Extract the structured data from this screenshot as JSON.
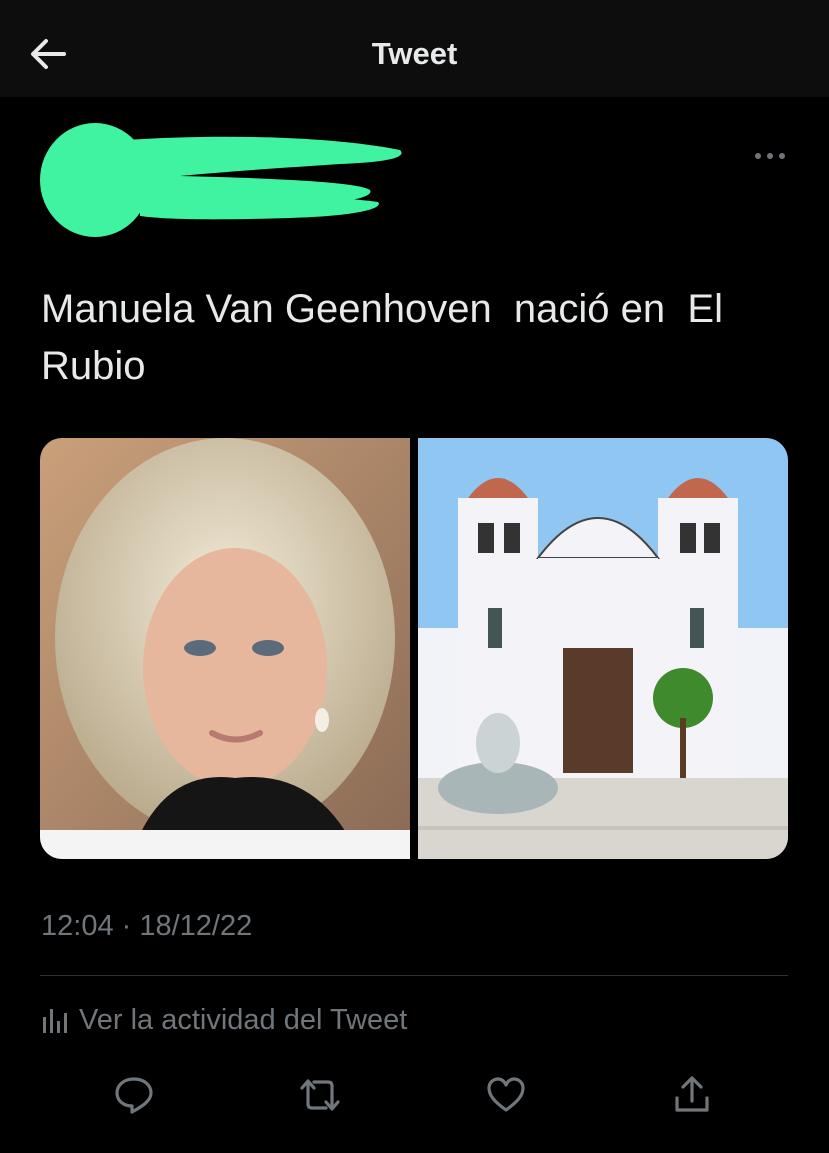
{
  "header": {
    "title": "Tweet",
    "back_icon": "arrow-left-icon"
  },
  "tweet": {
    "author_redacted": true,
    "text": "Manuela Van Geenhoven  nació en  El Rubio",
    "timestamp": "12:04 · 18/12/22",
    "activity_label": "Ver la actividad del Tweet",
    "media": [
      {
        "kind": "photo",
        "description_icon": "portrait-photo"
      },
      {
        "kind": "photo",
        "description_icon": "church-photo"
      }
    ]
  },
  "actions": [
    {
      "name": "reply",
      "icon": "reply-icon"
    },
    {
      "name": "retweet",
      "icon": "retweet-icon"
    },
    {
      "name": "like",
      "icon": "heart-icon"
    },
    {
      "name": "share",
      "icon": "share-icon"
    }
  ],
  "colors": {
    "background": "#000000",
    "text": "#e7e9ea",
    "muted": "#71767b",
    "redaction": "#3ff3a0"
  }
}
